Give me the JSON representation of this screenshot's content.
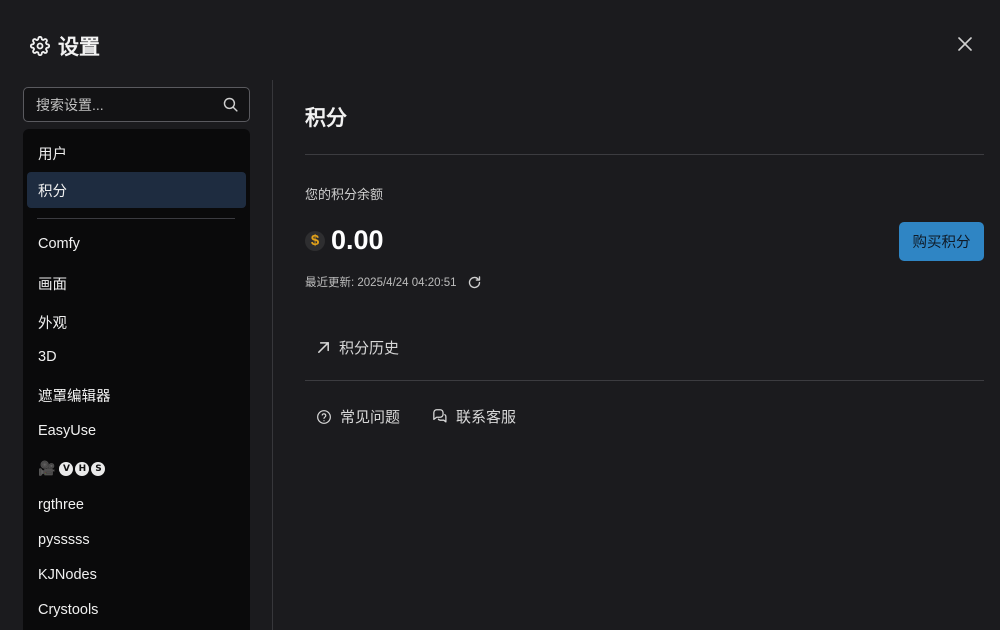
{
  "header": {
    "title": "设置"
  },
  "search": {
    "placeholder": "搜索设置..."
  },
  "sidebar": {
    "items": [
      {
        "label": "用户",
        "active": false
      },
      {
        "label": "积分",
        "active": true
      },
      {
        "label": "Comfy"
      },
      {
        "label": "画面"
      },
      {
        "label": "外观"
      },
      {
        "label": "3D"
      },
      {
        "label": "遮罩编辑器"
      },
      {
        "label": "EasyUse"
      },
      {
        "label": "🎥VHS",
        "badges": [
          "V",
          "H",
          "S"
        ]
      },
      {
        "label": "rgthree"
      },
      {
        "label": "pysssss"
      },
      {
        "label": "KJNodes"
      },
      {
        "label": "Crystools"
      }
    ]
  },
  "main": {
    "title": "积分",
    "balance_label": "您的积分余额",
    "currency_symbol": "$",
    "balance": "0.00",
    "buy_button": "购买积分",
    "last_updated_prefix": "最近更新: ",
    "last_updated_value": "2025/4/24 04:20:51",
    "history_link": "积分历史",
    "faq_link": "常见问题",
    "support_link": "联系客服"
  },
  "colors": {
    "background": "#1b1b1e",
    "sidebar_bg": "#0a0a0b",
    "active_item": "#1e2c40",
    "accent_button": "#2f85c4",
    "dollar_gold": "#e3a21a"
  }
}
